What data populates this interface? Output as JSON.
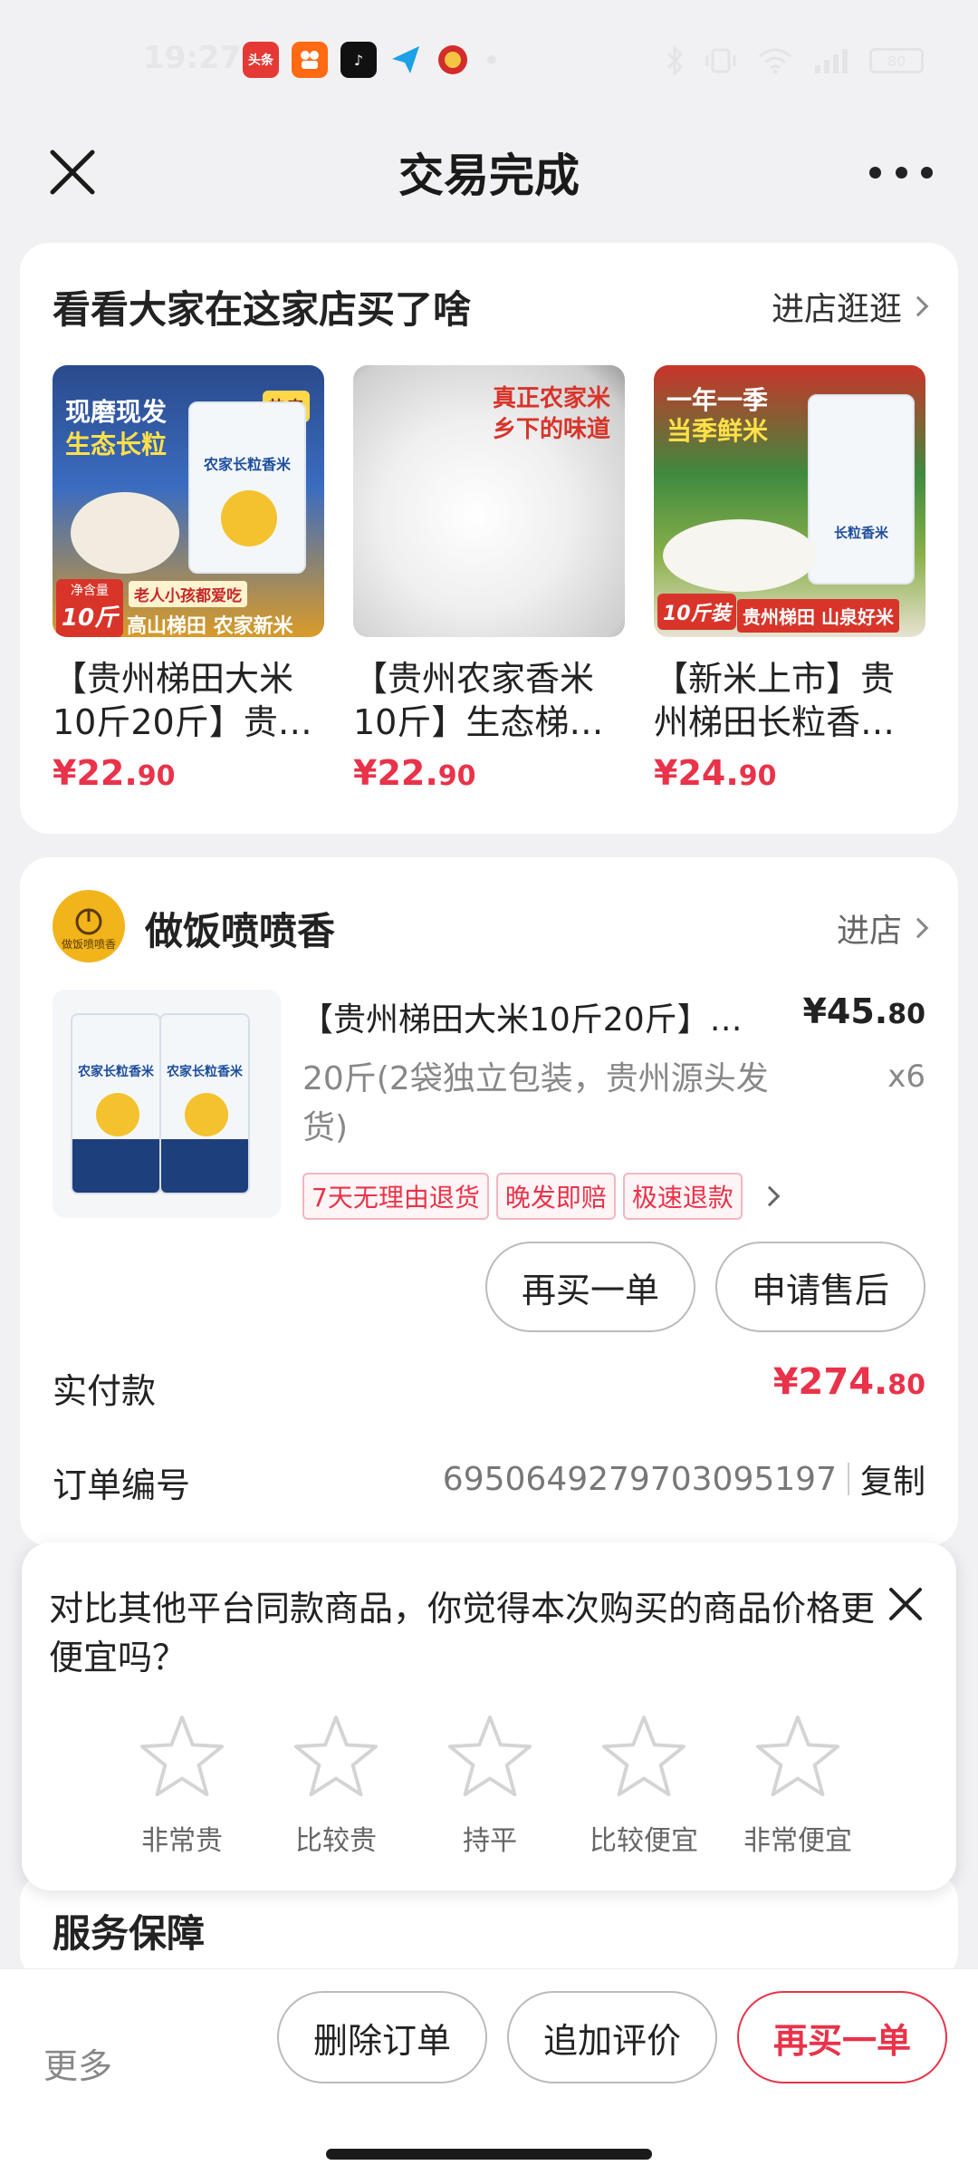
{
  "status_bar": {
    "time": "19:27",
    "apps": [
      {
        "icon": "toutiao-icon",
        "label": "头条",
        "color": "#e53935"
      },
      {
        "icon": "kuaishou-icon",
        "label": "",
        "color": "#ff6a13"
      },
      {
        "icon": "tiktok-icon",
        "label": "♪",
        "color": "#111111"
      },
      {
        "icon": "paper-plane-icon",
        "label": "",
        "color": "#1aa1e8"
      },
      {
        "icon": "gov-app-icon",
        "label": "",
        "color": "#d42b2b"
      }
    ],
    "battery": "80"
  },
  "nav": {
    "title": "交易完成"
  },
  "recommend": {
    "title": "看看大家在这家店买了啥",
    "link": "进店逛逛",
    "items": [
      {
        "name": "【贵州梯田大米10斤20斤】贵…",
        "price_int": "¥22.",
        "price_dec": "90",
        "badge_top": "现磨现发",
        "badge_top2": "生态长粒",
        "badge_hot": "热卖",
        "bag_label": "农家长粒香米",
        "weight": "10斤",
        "weight_label": "净含量",
        "banner": "高山梯田 农家新米",
        "slogan": "老人小孩都爱吃"
      },
      {
        "name": "【贵州农家香米10斤】生态梯…",
        "price_int": "¥22.",
        "price_dec": "90",
        "caption": "真正农家米",
        "caption2": "乡下的味道"
      },
      {
        "name": "【新米上市】贵州梯田长粒香…",
        "price_int": "¥24.",
        "price_dec": "90",
        "headline": "一年一季",
        "headline2": "当季鲜米",
        "weight": "10斤装",
        "banner": "贵州梯田 山泉好米",
        "bag_label": "长粒香米"
      }
    ]
  },
  "order": {
    "shop_name": "做饭喷喷香",
    "shop_logo_text": "做饭喷喷香",
    "shop_link": "进店",
    "product": {
      "name": "【贵州梯田大米10斤20斤】…",
      "price_int": "¥45.",
      "price_dec": "80",
      "spec": "20斤(2袋独立包装，贵州源头发货)",
      "qty": "x6",
      "bag_label": "农家长粒香米",
      "tags": [
        "7天无理由退货",
        "晚发即赔",
        "极速退款"
      ]
    },
    "buttons": {
      "rebuy": "再买一单",
      "after_sale": "申请售后"
    },
    "paid_label": "实付款",
    "paid_int": "¥274.",
    "paid_dec": "80",
    "order_no_label": "订单编号",
    "order_no": "6950649279703095197",
    "copy": "复制"
  },
  "survey": {
    "question": "对比其他平台同款商品，你觉得本次购买的商品价格更便宜吗？",
    "options": [
      "非常贵",
      "比较贵",
      "持平",
      "比较便宜",
      "非常便宜"
    ]
  },
  "service": {
    "title": "服务保障"
  },
  "bottom_bar": {
    "more": "更多",
    "delete": "删除订单",
    "review": "追加评价",
    "rebuy": "再买一单"
  }
}
